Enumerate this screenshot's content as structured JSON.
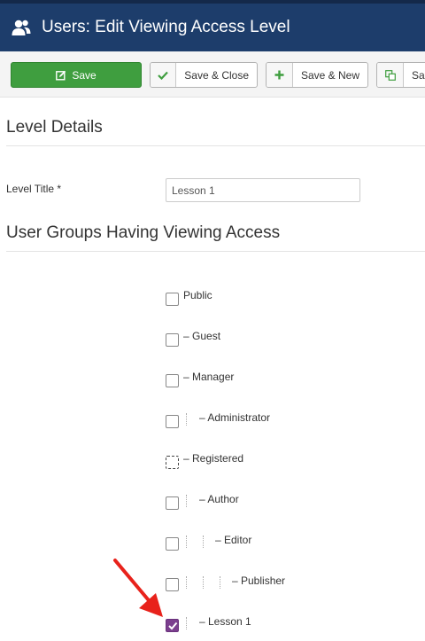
{
  "header": {
    "title": "Users: Edit Viewing Access Level",
    "icon": "users-icon"
  },
  "toolbar": {
    "save_label": "Save",
    "save_close_label": "Save & Close",
    "save_new_label": "Save & New",
    "save_copy_label": "Sa",
    "save_color": "#3f9e3f"
  },
  "level_details": {
    "heading": "Level Details",
    "title_label": "Level Title *",
    "title_value": "Lesson 1"
  },
  "groups_section": {
    "heading": "User Groups Having Viewing Access",
    "groups": [
      {
        "label": "Public",
        "checked": false
      },
      {
        "label": "– Guest",
        "checked": false
      },
      {
        "label": "– Manager",
        "checked": false
      },
      {
        "label": "– Administrator",
        "checked": false
      },
      {
        "label": "– Registered",
        "checked": false
      },
      {
        "label": "– Author",
        "checked": false
      },
      {
        "label": "– Editor",
        "checked": false
      },
      {
        "label": "– Publisher",
        "checked": false
      },
      {
        "label": "– Lesson 1",
        "checked": true
      }
    ]
  },
  "accent_color": "#7b3f8e",
  "annotation_arrow_color": "#e8221b"
}
